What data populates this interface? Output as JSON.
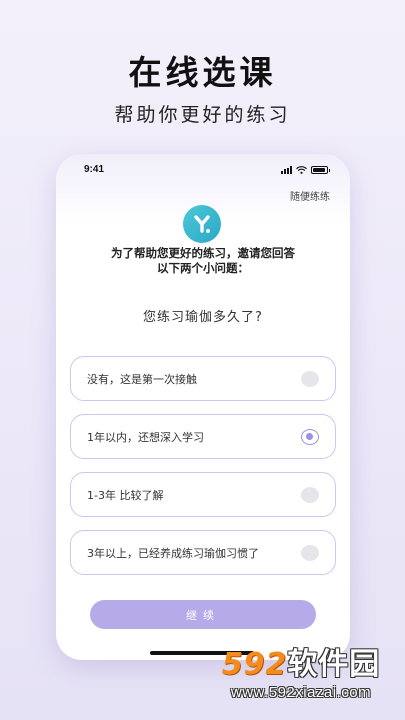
{
  "hero": {
    "title": "在线选课",
    "subtitle": "帮助你更好的练习"
  },
  "status_bar": {
    "time": "9:41",
    "icons": [
      "signal-icon",
      "wifi-icon",
      "battery-icon"
    ]
  },
  "skip_label": "随便练练",
  "logo_icon": "app-logo-icon",
  "intro": {
    "line1": "为了帮助您更好的练习，邀请您回答",
    "line2": "以下两个小问题："
  },
  "question": "您练习瑜伽多久了?",
  "options": [
    {
      "label": "没有，这是第一次接触",
      "selected": false
    },
    {
      "label": "1年以内，还想深入学习",
      "selected": true
    },
    {
      "label": "1-3年 比较了解",
      "selected": false
    },
    {
      "label": "3年以上，已经养成练习瑜伽习惯了",
      "selected": false
    }
  ],
  "continue_label": "继续",
  "colors": {
    "accent": "#9d8fe3",
    "button": "#b7aae8",
    "logo": "#2aa9c6"
  },
  "watermark": {
    "logo_num": "592",
    "logo_cn": "软件园",
    "url": "www.592xiazai.com"
  }
}
